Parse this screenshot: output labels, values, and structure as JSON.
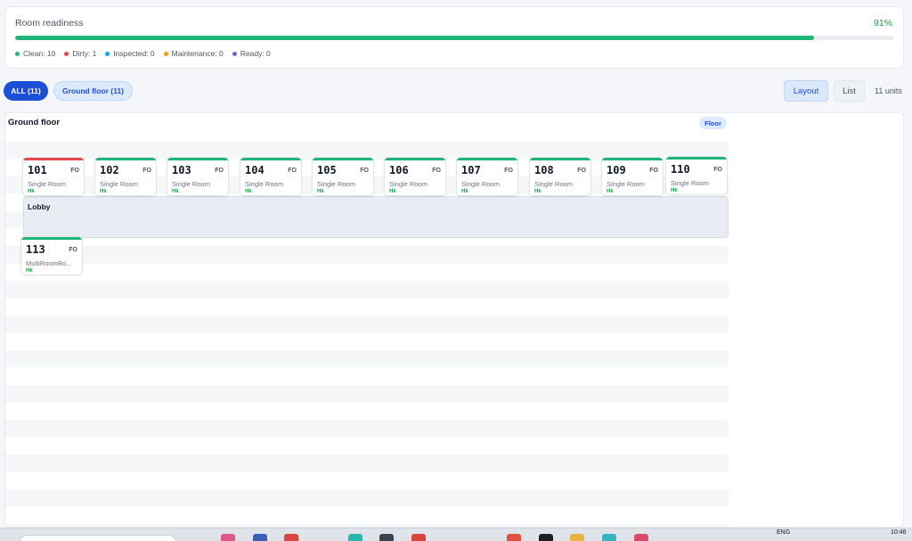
{
  "readiness": {
    "title": "Room readiness",
    "percent_text": "91%",
    "progress": 0.91,
    "legend": [
      {
        "label": "Clean: 10",
        "color": "#1fb57a"
      },
      {
        "label": "Dirty: 1",
        "color": "#e5484d"
      },
      {
        "label": "Inspected: 0",
        "color": "#0ea5e9"
      },
      {
        "label": "Maintenance: 0",
        "color": "#f59e0b"
      },
      {
        "label": "Ready: 0",
        "color": "#7c5cd6"
      }
    ]
  },
  "filters": {
    "all_label": "ALL (11)",
    "floor_label": "Ground floor (11)"
  },
  "view": {
    "layout_label": "Layout",
    "list_label": "List",
    "units_text": "11 units"
  },
  "floor": {
    "title": "Ground floor",
    "badge": "Floor",
    "lobby_label": "Lobby"
  },
  "rooms": [
    {
      "number": "101",
      "fo": "FO",
      "type": "Single Room",
      "hk": "Hk",
      "status": "dirty"
    },
    {
      "number": "102",
      "fo": "FO",
      "type": "Single Room",
      "hk": "Hk",
      "status": "clean"
    },
    {
      "number": "103",
      "fo": "FO",
      "type": "Single Room",
      "hk": "Hk",
      "status": "clean"
    },
    {
      "number": "104",
      "fo": "FO",
      "type": "Single Room",
      "hk": "Hk",
      "status": "clean"
    },
    {
      "number": "105",
      "fo": "FO",
      "type": "Single Room",
      "hk": "Hk",
      "status": "clean"
    },
    {
      "number": "106",
      "fo": "FO",
      "type": "Single Room",
      "hk": "Hk",
      "status": "clean"
    },
    {
      "number": "107",
      "fo": "FO",
      "type": "Single Room",
      "hk": "Hk",
      "status": "clean"
    },
    {
      "number": "108",
      "fo": "FO",
      "type": "Single Room",
      "hk": "Hk",
      "status": "clean"
    },
    {
      "number": "109",
      "fo": "FO",
      "type": "Single Room",
      "hk": "Hk",
      "status": "clean"
    },
    {
      "number": "110",
      "fo": "FO",
      "type": "Single Room",
      "hk": "Hk",
      "status": "clean"
    },
    {
      "number": "113",
      "fo": "FO",
      "type": "MultiRoomBo...",
      "hk": "Hk",
      "status": "clean"
    }
  ],
  "status_colors": {
    "clean": "#1fb57a",
    "dirty": "#e5484d"
  },
  "taskbar": {
    "lang": "ENG",
    "time": "10:46"
  }
}
